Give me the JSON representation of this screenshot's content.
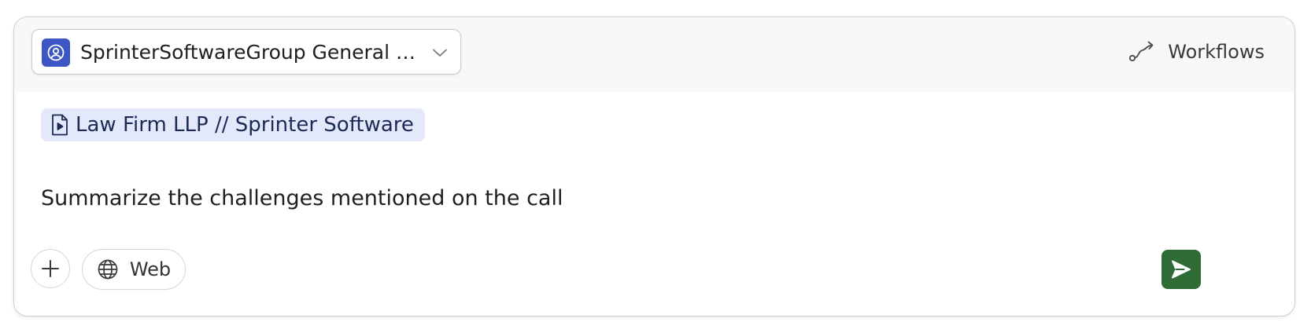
{
  "assistant_selector": {
    "name": "SprinterSoftwareGroup General Assis...",
    "avatar_icon": "user-circle-icon",
    "avatar_color": "#3d56c6",
    "dropdown_icon": "chevron-down-icon"
  },
  "header": {
    "workflows_label": "Workflows",
    "workflows_icon": "workflow-route-icon"
  },
  "context": {
    "chip_label": "Law Firm LLP // Sprinter Software",
    "chip_icon": "video-file-icon",
    "chip_bg": "#e3e9fa"
  },
  "composer": {
    "prompt_text": "Summarize the challenges mentioned on the call"
  },
  "toolbar": {
    "add_icon": "plus-icon",
    "web_label": "Web",
    "web_icon": "globe-icon",
    "send_icon": "send-icon",
    "send_color": "#2f6b35"
  }
}
